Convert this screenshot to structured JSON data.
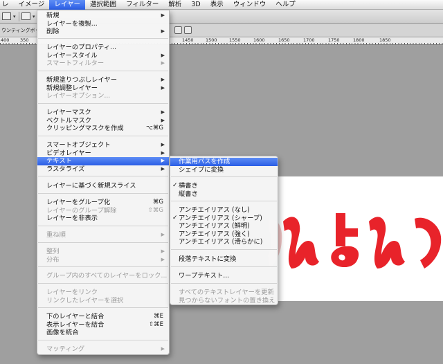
{
  "menubar": {
    "items": [
      "レ",
      "イメージ",
      "レイヤー",
      "選択範囲",
      "フィルター",
      "解析",
      "3D",
      "表示",
      "ウィンドウ",
      "ヘルプ"
    ],
    "active_index": 2
  },
  "tabrow": {
    "text": "ウンティングボッ"
  },
  "ruler": {
    "labels": [
      "400",
      "350",
      "1450",
      "1500",
      "1550",
      "1600",
      "1650",
      "1700",
      "1750",
      "1800",
      "1850"
    ]
  },
  "layer_menu": {
    "items": [
      {
        "label": "新規",
        "arrow": true
      },
      {
        "label": "レイヤーを複製..."
      },
      {
        "label": "削除",
        "arrow": true
      },
      {
        "label": "レイヤーのプロパティ..."
      },
      {
        "label": "レイヤースタイル",
        "arrow": true
      },
      {
        "label": "スマートフィルター",
        "arrow": true,
        "disabled": true
      },
      {
        "label": "新規塗りつぶしレイヤー",
        "arrow": true
      },
      {
        "label": "新規調整レイヤー",
        "arrow": true
      },
      {
        "label": "レイヤーオプション...",
        "disabled": true
      },
      {
        "label": "レイヤーマスク",
        "arrow": true
      },
      {
        "label": "ベクトルマスク",
        "arrow": true
      },
      {
        "label": "クリッピングマスクを作成",
        "shortcut": "⌥⌘G"
      },
      {
        "label": "スマートオブジェクト",
        "arrow": true
      },
      {
        "label": "ビデオレイヤー",
        "arrow": true
      },
      {
        "label": "テキスト",
        "arrow": true,
        "highlighted": true
      },
      {
        "label": "ラスタライズ",
        "arrow": true
      },
      {
        "label": "レイヤーに基づく新規スライス"
      },
      {
        "label": "レイヤーをグループ化",
        "shortcut": "⌘G"
      },
      {
        "label": "レイヤーのグループ解除",
        "shortcut": "⇧⌘G",
        "disabled": true
      },
      {
        "label": "レイヤーを非表示"
      },
      {
        "label": "重ね順",
        "arrow": true,
        "disabled": true
      },
      {
        "label": "整列",
        "arrow": true,
        "disabled": true
      },
      {
        "label": "分布",
        "arrow": true,
        "disabled": true
      },
      {
        "label": "グループ内のすべてのレイヤーをロック...",
        "disabled": true
      },
      {
        "label": "レイヤーをリンク",
        "disabled": true
      },
      {
        "label": "リンクしたレイヤーを選択",
        "disabled": true
      },
      {
        "label": "下のレイヤーと結合",
        "shortcut": "⌘E"
      },
      {
        "label": "表示レイヤーを結合",
        "shortcut": "⇧⌘E"
      },
      {
        "label": "画像を統合"
      },
      {
        "label": "マッティング",
        "arrow": true,
        "disabled": true
      }
    ]
  },
  "text_submenu": {
    "items": [
      {
        "label": "作業用パスを作成",
        "highlighted": true
      },
      {
        "label": "シェイプに変換"
      },
      {
        "label": "横書き",
        "checked": true
      },
      {
        "label": "縦書き"
      },
      {
        "label": "アンチエイリアス (なし)"
      },
      {
        "label": "アンチエイリアス (シャープ)",
        "checked": true
      },
      {
        "label": "アンチエイリアス (鮮明)"
      },
      {
        "label": "アンチエイリアス (強く)"
      },
      {
        "label": "アンチエイリアス (滑らかに)"
      },
      {
        "label": "段落テキストに変換"
      },
      {
        "label": "ワープテキスト..."
      },
      {
        "label": "すべてのテキストレイヤーを更新",
        "disabled": true
      },
      {
        "label": "見つからないフォントの置き換え",
        "disabled": true
      }
    ]
  },
  "symbols": {
    "arrow": "▶",
    "check": "✓"
  },
  "colors": {
    "highlight": "#2b5ee6",
    "art_red": "#e8232a",
    "art_shadow": "#f3c8c8"
  }
}
